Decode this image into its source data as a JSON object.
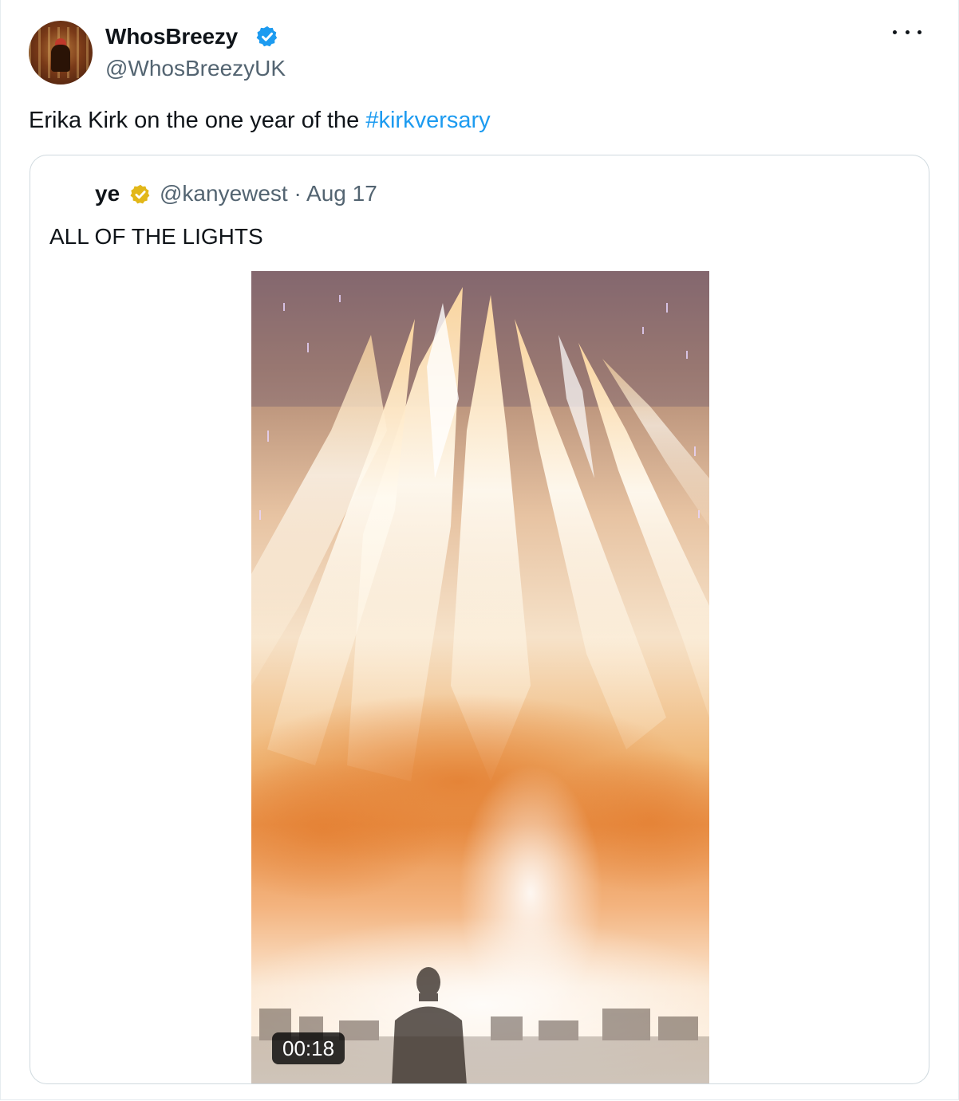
{
  "tweet": {
    "author": {
      "display_name": "WhosBreezy",
      "handle": "@WhosBreezyUK",
      "verified": "blue"
    },
    "text": "Erika Kirk on the one year of the ",
    "hashtag": "#kirkversary",
    "more_icon": "more-horizontal-icon"
  },
  "quoted_tweet": {
    "author": {
      "display_name": "ye",
      "verified": "gold"
    },
    "handle_and_date": "@kanyewest · Aug 17",
    "text": "ALL OF THE LIGHTS",
    "media": {
      "type": "video",
      "duration": "00:18"
    }
  },
  "colors": {
    "link": "#1d9bf0",
    "verified_blue": "#1d9bf0",
    "verified_gold": "#e2b719",
    "secondary_text": "#536471",
    "border": "#cfd9de"
  }
}
